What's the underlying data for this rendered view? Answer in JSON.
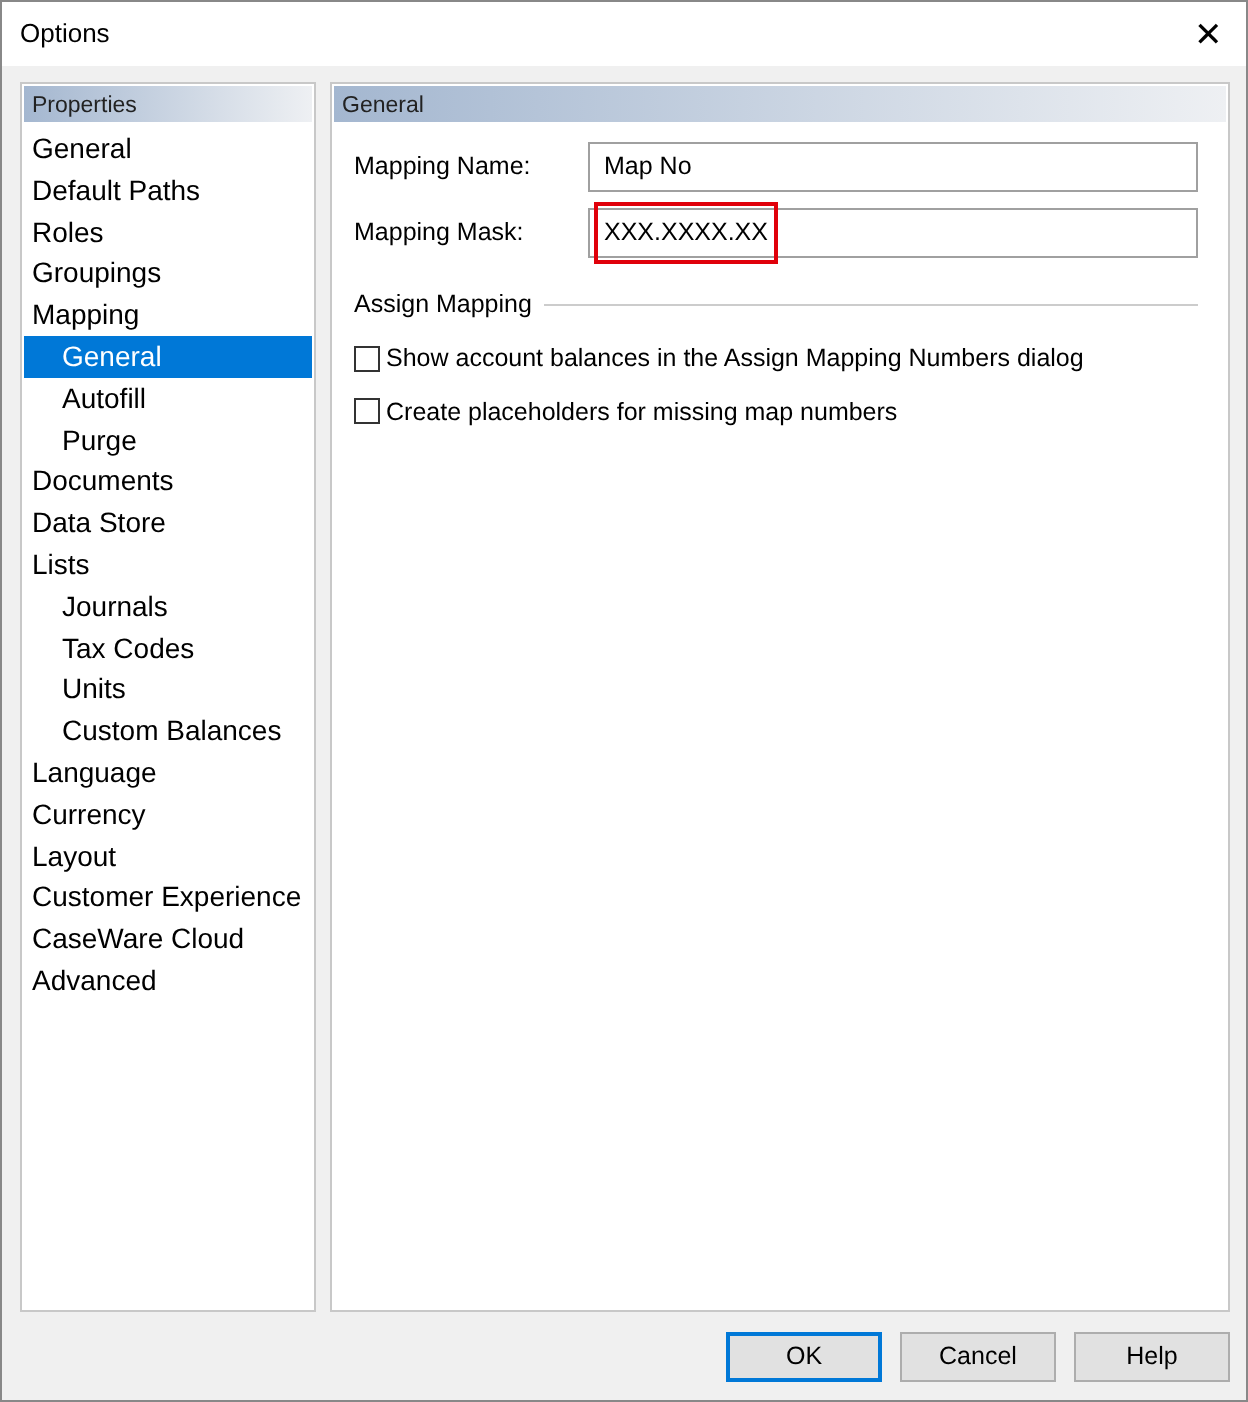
{
  "window": {
    "title": "Options",
    "close": "✕"
  },
  "sidebar": {
    "header": "Properties",
    "items": [
      {
        "label": "General",
        "selected": false
      },
      {
        "label": "Default Paths",
        "selected": false
      },
      {
        "label": "Roles",
        "selected": false
      },
      {
        "label": "Groupings",
        "selected": false
      },
      {
        "label": "Mapping",
        "selected": false,
        "children": [
          {
            "label": "General",
            "selected": true
          },
          {
            "label": "Autofill",
            "selected": false
          },
          {
            "label": "Purge",
            "selected": false
          }
        ]
      },
      {
        "label": "Documents",
        "selected": false
      },
      {
        "label": "Data Store",
        "selected": false
      },
      {
        "label": "Lists",
        "selected": false,
        "children": [
          {
            "label": "Journals",
            "selected": false
          },
          {
            "label": "Tax Codes",
            "selected": false
          },
          {
            "label": "Units",
            "selected": false
          },
          {
            "label": "Custom Balances",
            "selected": false
          }
        ]
      },
      {
        "label": "Language",
        "selected": false
      },
      {
        "label": "Currency",
        "selected": false
      },
      {
        "label": "Layout",
        "selected": false
      },
      {
        "label": "Customer Experience",
        "selected": false
      },
      {
        "label": "CaseWare Cloud",
        "selected": false
      },
      {
        "label": "Advanced",
        "selected": false
      }
    ]
  },
  "panel": {
    "header": "General",
    "fields": [
      {
        "label": "Mapping Name:",
        "value": "Map No",
        "highlighted": false
      },
      {
        "label": "Mapping Mask:",
        "value": "XXX.XXXX.XX",
        "highlighted": true
      }
    ],
    "group": "Assign Mapping",
    "checkboxes": [
      {
        "label": "Show account balances in the Assign Mapping Numbers dialog",
        "checked": false
      },
      {
        "label": "Create placeholders for missing map numbers",
        "checked": false
      }
    ]
  },
  "buttons": [
    {
      "label": "OK",
      "default": true
    },
    {
      "label": "Cancel",
      "default": false
    },
    {
      "label": "Help",
      "default": false
    }
  ]
}
